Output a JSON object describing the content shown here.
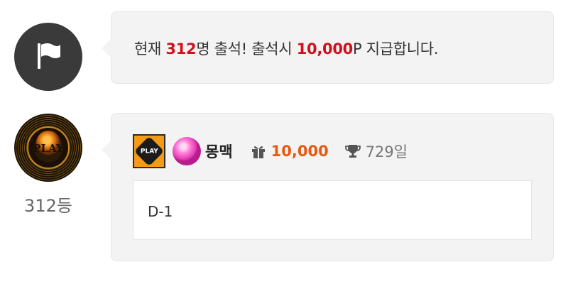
{
  "notice": {
    "icon": "flag-icon",
    "prefix": "현재 ",
    "count": "312",
    "middle": "명 출석! 출석시 ",
    "points": "10,000",
    "suffix": "P 지급합니다."
  },
  "entry": {
    "avatar_text": "PLAY",
    "rank": "312등",
    "level_badge_text": "PLAY",
    "nickname": "몽맥",
    "gift_icon": "gift-icon",
    "points": "10,000",
    "trophy_icon": "trophy-icon",
    "days": "729일",
    "comment": "D-1"
  },
  "colors": {
    "highlight_red": "#d0101e",
    "points_orange": "#e8590c",
    "bubble_bg": "#f3f3f3",
    "flag_avatar_bg": "#3a3a3a"
  }
}
